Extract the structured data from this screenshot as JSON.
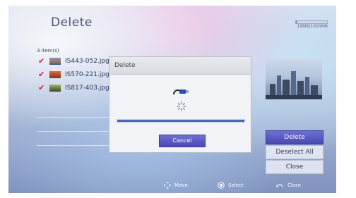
{
  "header": {
    "title": "Delete",
    "subtitle": "",
    "storage": "19MB/1000MB",
    "storage_used_fraction": 0.019
  },
  "list": {
    "count_label": "3 item(s)",
    "items": [
      {
        "name": "IS443-052.jpg",
        "checked": true
      },
      {
        "name": "IS570-221.jpg",
        "checked": true
      },
      {
        "name": "IS817-403.jpg",
        "checked": true
      }
    ]
  },
  "dialog": {
    "title": "Delete",
    "cancel_label": "Cancel",
    "progress": 1.0
  },
  "actions": {
    "delete_label": "Delete",
    "deselect_all_label": "Deselect All",
    "close_label": "Close"
  },
  "footer": {
    "move_label": "Move",
    "select_label": "Select",
    "close_label": "Close"
  },
  "colors": {
    "accent": "#4a47b0",
    "check": "#d0223a",
    "progress": "#4d67b3"
  },
  "icons": {
    "check": "check-icon",
    "plug": "usb-plug-icon",
    "spinner": "loading-spinner-icon",
    "move": "dpad-arrows-icon",
    "select": "ok-button-icon",
    "close": "return-icon"
  }
}
